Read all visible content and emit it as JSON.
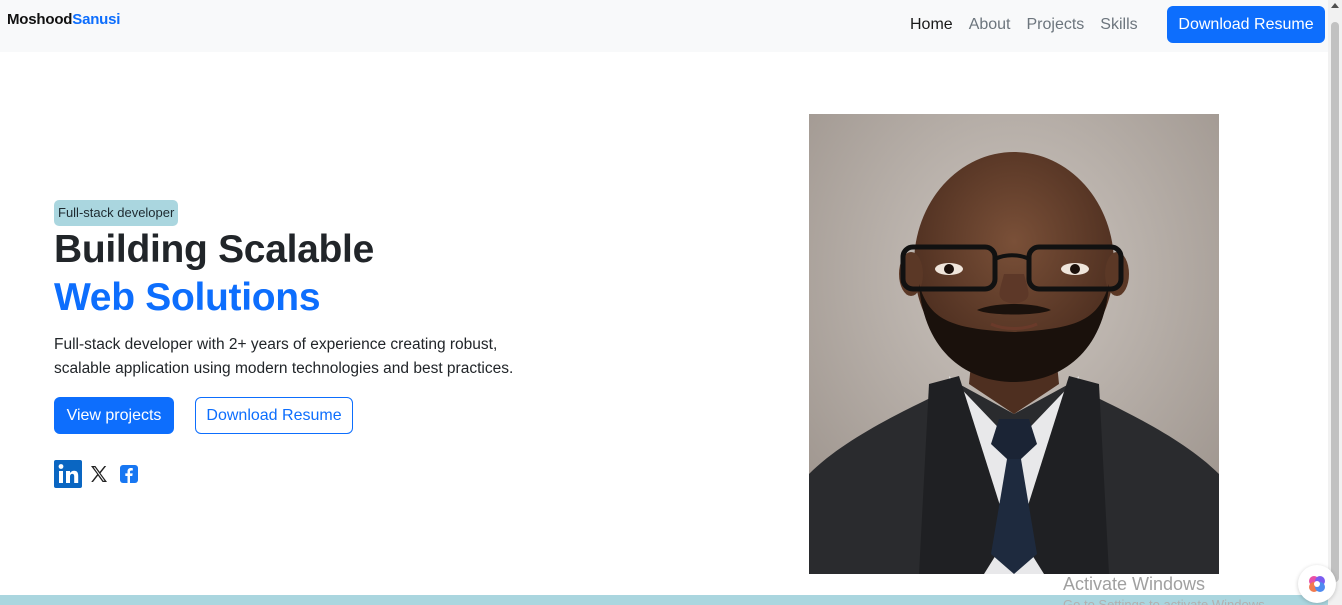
{
  "navbar": {
    "brand_first": "Moshood",
    "brand_last": "Sanusi",
    "links": [
      {
        "label": "Home",
        "active": true
      },
      {
        "label": "About",
        "active": false
      },
      {
        "label": "Projects",
        "active": false
      },
      {
        "label": "Skills",
        "active": false
      }
    ],
    "cta_label": "Download Resume"
  },
  "hero": {
    "badge": "Full-stack developer",
    "title_line1": "Building Scalable",
    "title_line2": "Web Solutions",
    "description": "Full-stack developer with 2+ years of experience creating robust, scalable application using modern technologies and best practices.",
    "primary_button": "View projects",
    "secondary_button": "Download Resume",
    "socials": [
      "linkedin-icon",
      "x-icon",
      "facebook-icon"
    ]
  },
  "colors": {
    "accent": "#0d6efd",
    "badge_bg": "#aad6df",
    "navbar_bg": "#f8f9fa"
  },
  "watermark": {
    "title": "Activate Windows",
    "subtitle": "Go to Settings to activate Windows."
  }
}
